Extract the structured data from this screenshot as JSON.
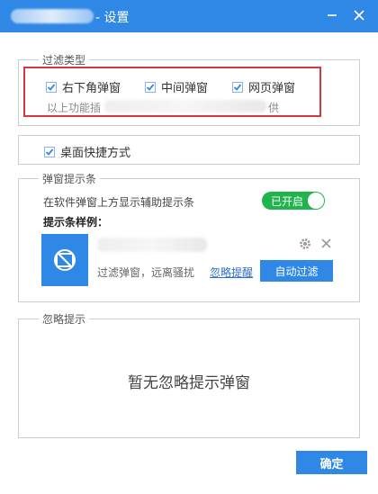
{
  "window": {
    "title": "- 设置",
    "minimize_icon": "minimize-icon",
    "close_icon": "close-icon"
  },
  "filter_section": {
    "legend": "过滤类型",
    "options": [
      {
        "label": "右下角弹窗",
        "checked": true
      },
      {
        "label": "中间弹窗",
        "checked": true
      },
      {
        "label": "网页弹窗",
        "checked": true
      }
    ],
    "note_prefix": "以上功能插",
    "note_suffix": "供"
  },
  "desktop_shortcut": {
    "label": "桌面快捷方式",
    "checked": true
  },
  "popup_bar": {
    "legend": "弹窗提示条",
    "toggle_desc": "在软件弹窗上方显示辅助提示条",
    "toggle_label": "已开启",
    "toggle_on": true,
    "sample_title": "提示条样例：",
    "sample_slogan": "过滤弹窗，远离骚扰",
    "ignore_link": "忽略提醒",
    "auto_filter_button": "自动过滤",
    "icon_names": [
      "no-popup-icon",
      "gear-icon",
      "close-icon"
    ]
  },
  "ignore_section": {
    "legend": "忽略提示",
    "empty_text": "暂无忽略提示弹窗"
  },
  "footer": {
    "confirm_button": "确定"
  },
  "colors": {
    "accent": "#2f87e6",
    "toggle_on": "#1fb54c",
    "highlight_border": "#d9363e"
  }
}
